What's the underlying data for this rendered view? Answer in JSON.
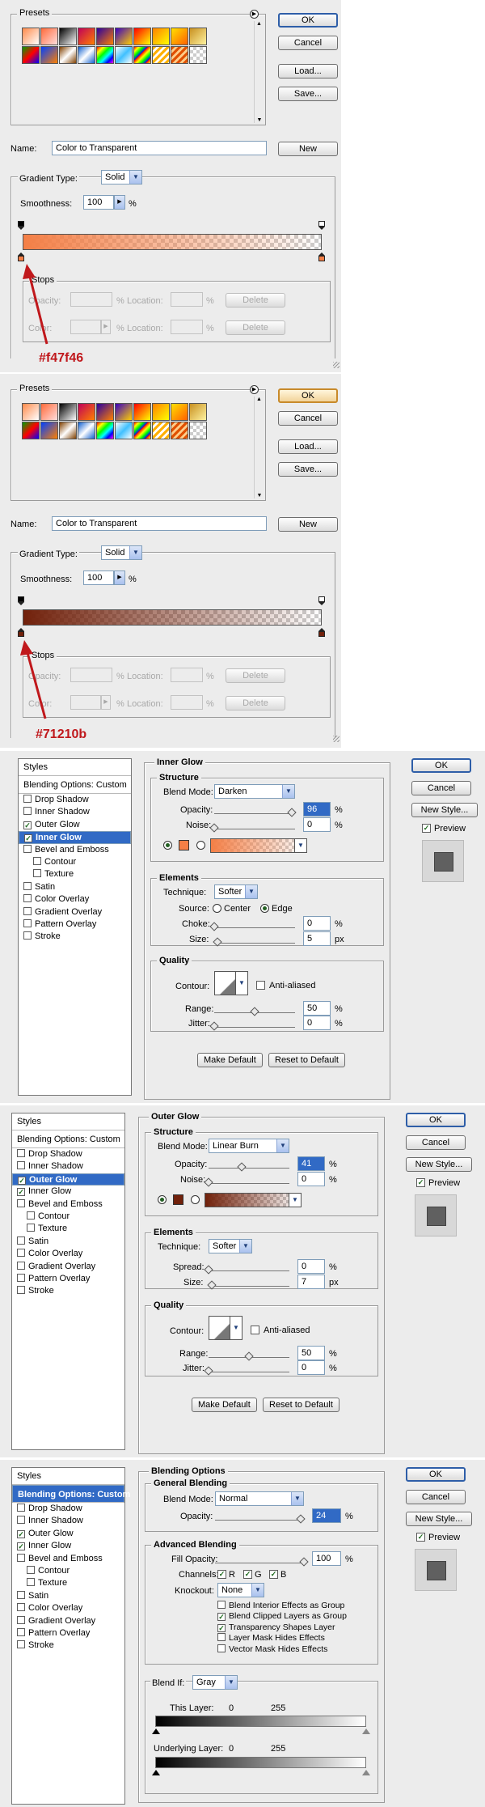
{
  "gradient_editor": {
    "presets_label": "Presets",
    "ok": "OK",
    "cancel": "Cancel",
    "load": "Load...",
    "save": "Save...",
    "name_label": "Name:",
    "name_value": "Color to Transparent",
    "new": "New",
    "gradient_type_label": "Gradient Type:",
    "gradient_type_value": "Solid",
    "smoothness_label": "Smoothness:",
    "smoothness_value": "100",
    "percent": "%",
    "stops_label": "Stops",
    "opacity_label": "Opacity:",
    "color_label": "Color:",
    "location_label": "Location:",
    "delete": "Delete"
  },
  "annotations": {
    "color1": "#f47f46",
    "color2": "#71210b"
  },
  "colors": {
    "stop1": "#f47f46",
    "stop2": "#71210b"
  },
  "styles_list": {
    "title": "Styles",
    "blending": "Blending Options: Custom",
    "items": [
      "Drop Shadow",
      "Inner Shadow",
      "Outer Glow",
      "Inner Glow",
      "Bevel and Emboss",
      "Contour",
      "Texture",
      "Satin",
      "Color Overlay",
      "Gradient Overlay",
      "Pattern Overlay",
      "Stroke"
    ]
  },
  "side_buttons": {
    "ok": "OK",
    "cancel": "Cancel",
    "new_style": "New Style...",
    "preview": "Preview"
  },
  "inner_glow": {
    "title": "Inner Glow",
    "structure": "Structure",
    "blend_mode_label": "Blend Mode:",
    "blend_mode_value": "Darken",
    "opacity_label": "Opacity:",
    "opacity_value": "96",
    "opacity_level": 96,
    "noise_label": "Noise:",
    "noise_value": "0",
    "elements": "Elements",
    "technique_label": "Technique:",
    "technique_value": "Softer",
    "source_label": "Source:",
    "center": "Center",
    "edge": "Edge",
    "choke_label": "Choke:",
    "choke_value": "0",
    "size_label": "Size:",
    "size_value": "5",
    "px": "px",
    "quality": "Quality",
    "contour_label": "Contour:",
    "anti_aliased": "Anti-aliased",
    "range_label": "Range:",
    "range_value": "50",
    "jitter_label": "Jitter:",
    "jitter_value": "0",
    "make_default": "Make Default",
    "reset_default": "Reset to Default"
  },
  "outer_glow": {
    "title": "Outer Glow",
    "structure": "Structure",
    "blend_mode_label": "Blend Mode:",
    "blend_mode_value": "Linear Burn",
    "opacity_label": "Opacity:",
    "opacity_value": "41",
    "opacity_level": 41,
    "noise_label": "Noise:",
    "noise_value": "0",
    "elements": "Elements",
    "technique_label": "Technique:",
    "technique_value": "Softer",
    "spread_label": "Spread:",
    "spread_value": "0",
    "size_label": "Size:",
    "size_value": "7",
    "px": "px",
    "quality": "Quality",
    "contour_label": "Contour:",
    "anti_aliased": "Anti-aliased",
    "range_label": "Range:",
    "range_value": "50",
    "jitter_label": "Jitter:",
    "jitter_value": "0",
    "make_default": "Make Default",
    "reset_default": "Reset to Default"
  },
  "blending_options": {
    "title": "Blending Options",
    "general": "General Blending",
    "blend_mode_label": "Blend Mode:",
    "blend_mode_value": "Normal",
    "opacity_label": "Opacity:",
    "opacity_value": "24",
    "advanced": "Advanced Blending",
    "fill_opacity_label": "Fill Opacity:",
    "fill_opacity_value": "100",
    "channels_label": "Channels:",
    "r": "R",
    "g": "G",
    "b": "B",
    "knockout_label": "Knockout:",
    "knockout_value": "None",
    "options": [
      "Blend Interior Effects as Group",
      "Blend Clipped Layers as Group",
      "Transparency Shapes Layer",
      "Layer Mask Hides Effects",
      "Vector Mask Hides Effects"
    ],
    "blend_if_label": "Blend If:",
    "blend_if_value": "Gray",
    "this_layer_label": "This Layer:",
    "underlying_label": "Underlying Layer:",
    "zero": "0",
    "max": "255"
  }
}
